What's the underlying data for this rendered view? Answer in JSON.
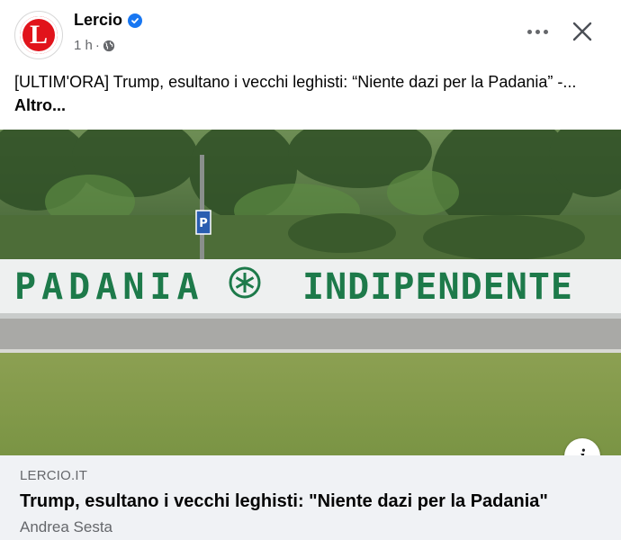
{
  "post": {
    "page_name": "Lercio",
    "avatar_letter": "L",
    "time": "1 h",
    "meta_separator": "·",
    "text": "[ULTIM'ORA] Trump, esultano i vecchi leghisti: “Niente dazi per la Padania” -... ",
    "see_more": "Altro..."
  },
  "photo": {
    "wall_left": "PADANIA",
    "wall_right": "INDIPENDENTE",
    "sign_letter": "P"
  },
  "link": {
    "domain": "LERCIO.IT",
    "title": "Trump, esultano i vecchi leghisti: \"Niente dazi per la Padania\"",
    "author": "Andrea Sesta",
    "info_icon": "i"
  },
  "colors": {
    "brand_red": "#e1131b",
    "verified_blue": "#1877f2",
    "wall_text_green": "#1d7a4a",
    "link_bg": "#f0f2f5"
  },
  "icons": [
    "verified-badge-icon",
    "globe-icon",
    "more-options-icon",
    "close-icon",
    "info-icon"
  ]
}
